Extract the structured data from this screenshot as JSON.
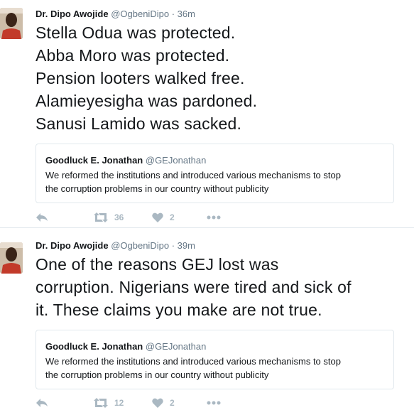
{
  "tweets": [
    {
      "author": {
        "fullname": "Dr. Dipo Awojide",
        "username": "@OgbeniDipo"
      },
      "separator": "·",
      "time": "36m",
      "text_lines": [
        "Stella Odua was protected.",
        "Abba Moro was protected.",
        "Pension looters walked free.",
        "Alamieyesigha was pardoned.",
        "Sanusi Lamido was sacked."
      ],
      "quote": {
        "fullname": "Goodluck E. Jonathan",
        "username": "@GEJonathan",
        "text_lines": [
          "We reformed the institutions and introduced various mechanisms to stop",
          "the corruption problems in our country without publicity"
        ]
      },
      "actions": {
        "reply_icon": "reply-icon",
        "retweet_count": "36",
        "like_count": "2",
        "more_icon": "more-icon"
      }
    },
    {
      "author": {
        "fullname": "Dr. Dipo Awojide",
        "username": "@OgbeniDipo"
      },
      "separator": "·",
      "time": "39m",
      "text_lines": [
        "One of the reasons GEJ lost was",
        "corruption. Nigerians were tired and sick of",
        "it. These claims you make are not true."
      ],
      "quote": {
        "fullname": "Goodluck E. Jonathan",
        "username": "@GEJonathan",
        "text_lines": [
          "We reformed the institutions and introduced various mechanisms to stop",
          "the corruption problems in our country without publicity"
        ]
      },
      "actions": {
        "reply_icon": "reply-icon",
        "retweet_count": "12",
        "like_count": "2",
        "more_icon": "more-icon"
      }
    }
  ],
  "colors": {
    "text": "#14171a",
    "secondary": "#657786",
    "icon": "#aab8c2",
    "border": "#e1e8ed"
  }
}
